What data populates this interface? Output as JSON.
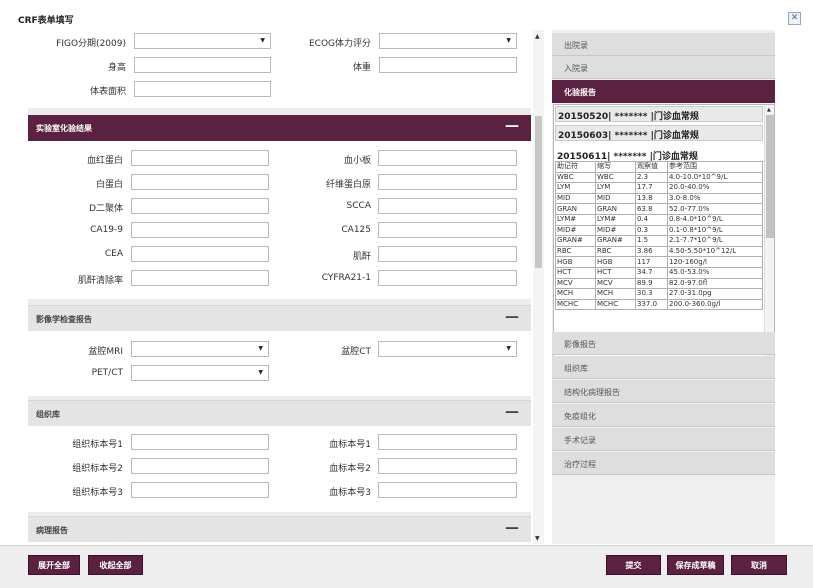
{
  "window": {
    "title": "CRF表单填写",
    "close_icon": "close-icon"
  },
  "basic": {
    "figo_label": "FIGO分期(2009)",
    "figo_value": "",
    "ecog_label": "ECOG体力评分",
    "ecog_value": "",
    "height_label": "身高",
    "weight_label": "体重",
    "bsa_label": "体表面积"
  },
  "lab_section": {
    "title": "实验室化验结果",
    "toggle": "—",
    "fields": {
      "hb": "血红蛋白",
      "plt": "血小板",
      "alb": "白蛋白",
      "fib": "纤维蛋白原",
      "dd": "D二聚体",
      "scca": "SCCA",
      "ca199": "CA19-9",
      "ca125": "CA125",
      "cea": "CEA",
      "cr": "肌酐",
      "ccr": "肌酐清除率",
      "cyfra": "CYFRA21-1"
    }
  },
  "imaging_section": {
    "title": "影像学检查报告",
    "toggle": "—",
    "mri_label": "盆腔MRI",
    "ct_label": "盆腔CT",
    "petct_label": "PET/CT"
  },
  "tissue_section": {
    "title": "组织库",
    "toggle": "—",
    "t1": "组织标本号1",
    "b1": "血标本号1",
    "t2": "组织标本号2",
    "b2": "血标本号2",
    "t3": "组织标本号3",
    "b3": "血标本号3"
  },
  "path_section": {
    "title": "病理报告",
    "toggle": "—"
  },
  "right_panel": {
    "items": [
      {
        "label": "出院录"
      },
      {
        "label": "入院录"
      },
      {
        "label": "化验报告"
      },
      {
        "label": "影像报告"
      },
      {
        "label": "组织库"
      },
      {
        "label": "结构化病理报告"
      },
      {
        "label": "免疫组化"
      },
      {
        "label": "手术记录"
      },
      {
        "label": "治疗过程"
      }
    ],
    "reports": [
      "20150520| ******* |门诊血常规",
      "20150603| ******* |门诊血常规",
      "20150611| ******* |门诊血常规"
    ],
    "table_header": [
      "助记符",
      "缩写",
      "观察值",
      "参考范围"
    ],
    "table_rows": [
      [
        "WBC",
        "WBC",
        "2.3",
        "4.0-10.0*10^9/L"
      ],
      [
        "LYM",
        "LYM",
        "17.7",
        "20.0-40.0%"
      ],
      [
        "MID",
        "MID",
        "13.8",
        "3.0-8.0%"
      ],
      [
        "GRAN",
        "GRAN",
        "63.8",
        "52.0-77.0%"
      ],
      [
        "LYM#",
        "LYM#",
        "0.4",
        "0.8-4.0*10^9/L"
      ],
      [
        "MID#",
        "MID#",
        "0.3",
        "0.1-0.8*10^9/L"
      ],
      [
        "GRAN#",
        "GRAN#",
        "1.5",
        "2.1-7.7*10^9/L"
      ],
      [
        "RBC",
        "RBC",
        "3.86",
        "4.50-5.50*10^12/L"
      ],
      [
        "HGB",
        "HGB",
        "117",
        "120-160g/l"
      ],
      [
        "HCT",
        "HCT",
        "34.7",
        "45.0-53.0%"
      ],
      [
        "MCV",
        "MCV",
        "89.9",
        "82.0-97.0fl"
      ],
      [
        "MCH",
        "MCH",
        "30.3",
        "27.0-31.0pg"
      ],
      [
        "MCHC",
        "MCHC",
        "337.0",
        "200.0-360.0g/l"
      ]
    ]
  },
  "bottom": {
    "expand_all": "展开全部",
    "collapse_all": "收起全部",
    "submit": "提交",
    "save_draft": "保存成草稿",
    "cancel": "取消"
  }
}
